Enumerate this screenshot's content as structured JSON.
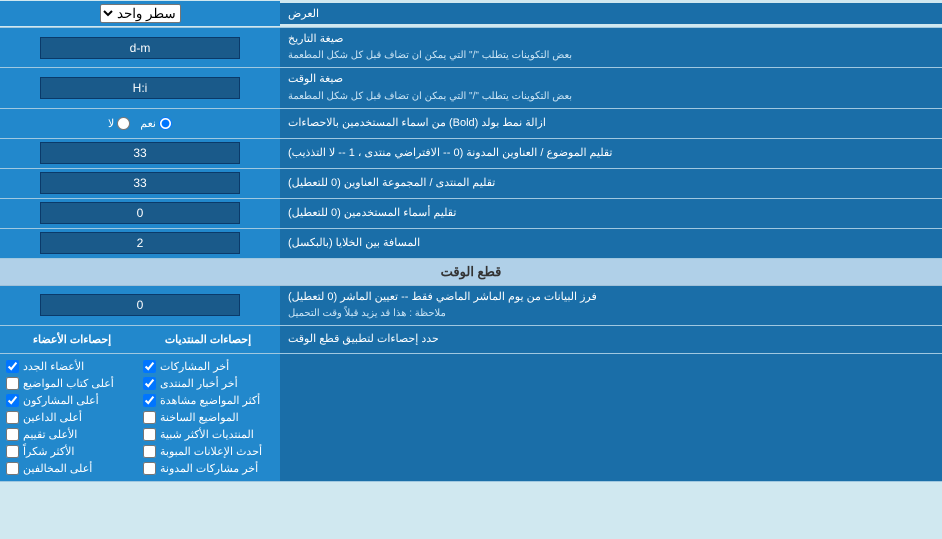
{
  "page": {
    "title": "العرض",
    "sections": [
      {
        "id": "display",
        "rows": [
          {
            "id": "display-type",
            "label": "العرض",
            "input_type": "select",
            "value": "سطر واحد"
          },
          {
            "id": "date-format",
            "label": "صيغة التاريخ",
            "sublabel": "بعض التكوينات يتطلب \"/\" التي يمكن ان تضاف قبل كل شكل المطعمة",
            "input_type": "text",
            "value": "d-m"
          },
          {
            "id": "time-format",
            "label": "صيغة الوقت",
            "sublabel": "بعض التكوينات يتطلب \"/\" التي يمكن ان تضاف قبل كل شكل المطعمة",
            "input_type": "text",
            "value": "H:i"
          },
          {
            "id": "bold-remove",
            "label": "ازالة نمط بولد (Bold) من اسماء المستخدمين بالاحصاءات",
            "input_type": "radio",
            "options": [
              "نعم",
              "لا"
            ],
            "selected": "نعم"
          },
          {
            "id": "topic-subject",
            "label": "تقليم الموضوع / العناوين المدونة (0 -- الافتراضي منتدى ، 1 -- لا التذذيب)",
            "input_type": "text",
            "value": "33"
          },
          {
            "id": "forum-group",
            "label": "تقليم المنتدى / المجموعة العناوين (0 للتعطيل)",
            "input_type": "text",
            "value": "33"
          },
          {
            "id": "usernames",
            "label": "تقليم أسماء المستخدمين (0 للتعطيل)",
            "input_type": "text",
            "value": "0"
          },
          {
            "id": "cell-spacing",
            "label": "المسافة بين الخلايا (بالبكسل)",
            "input_type": "text",
            "value": "2"
          }
        ]
      },
      {
        "id": "time-cutoff",
        "header": "قطع الوقت",
        "rows": [
          {
            "id": "filter-days",
            "label": "فرز البيانات من يوم الماشر الماضي فقط -- تعيين الماشر (0 لتعطيل)",
            "sublabel": "ملاحظة : هذا قد يزيد قبلاً وقت التحميل",
            "input_type": "text",
            "value": "0"
          }
        ]
      },
      {
        "id": "stats",
        "header_label": "حدد إحصاءات لتطبيق قطع الوقت",
        "columns": [
          {
            "id": "posts-stats",
            "header": "إحصاءات المنتديات",
            "items": [
              "أخر المشاركات",
              "أخر أخبار المنتدى",
              "أكثر المواضيع مشاهدة",
              "المواضيع الساخنة",
              "المنتديات الأكثر شبية",
              "أحدث الإعلانات المبوبة",
              "أخر مشاركات المدونة"
            ]
          },
          {
            "id": "members-stats",
            "header": "إحصاءات الأعضاء",
            "items": [
              "الأعضاء الجدد",
              "أعلى كتاب المواضيع",
              "أعلى المشاركون",
              "أعلى الداعين",
              "الأعلى تقييم",
              "الأكثر شكراً",
              "أعلى المخالفين"
            ]
          }
        ]
      }
    ]
  }
}
